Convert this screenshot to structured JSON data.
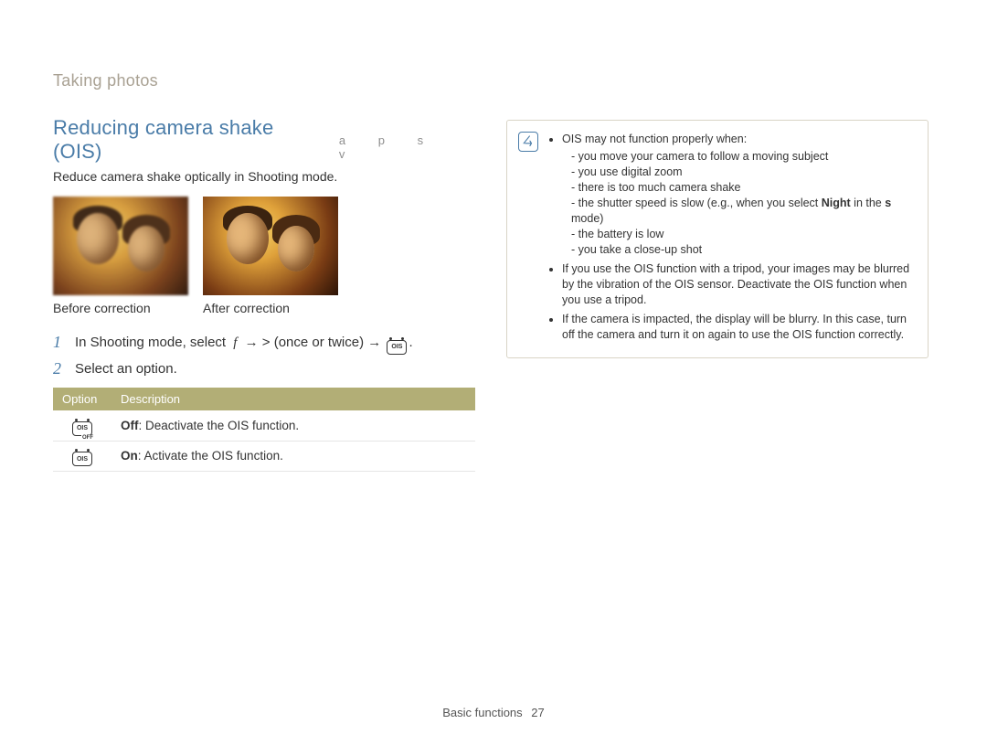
{
  "breadcrumb": "Taking photos",
  "title": "Reducing camera shake (OIS)",
  "mode_letters": "a   p   s      v",
  "intro": "Reduce camera shake optically in Shooting mode.",
  "captions": {
    "before": "Before correction",
    "after": "After correction"
  },
  "steps": {
    "s1_a": "In Shooting mode, select",
    "s1_b": "f",
    "s1_c": "→ > (once or twice) →",
    "s1_d": ".",
    "s2": "Select an option."
  },
  "table": {
    "headers": {
      "option": "Option",
      "description": "Description"
    },
    "rows": [
      {
        "icon_sub": "OFF",
        "bold": "Off",
        "text": ": Deactivate the OIS function."
      },
      {
        "icon_sub": "",
        "bold": "On",
        "text": ": Activate the OIS function."
      }
    ]
  },
  "note": {
    "lead": "OIS may not function properly when:",
    "reasons": [
      "you move your camera to follow a moving subject",
      "you use digital zoom",
      "there is too much camera shake"
    ],
    "shutter_a": "the shutter speed is slow (e.g., when you select ",
    "shutter_bold": "Night",
    "shutter_b": " in the ",
    "shutter_mode": "s",
    "shutter_c": " mode)",
    "reasons2": [
      "the battery is low",
      "you take a close-up shot"
    ],
    "bullet2": "If you use the OIS function with a tripod, your images may be blurred by the vibration of the OIS sensor. Deactivate the OIS function when you use a tripod.",
    "bullet3": "If the camera is impacted, the display will be blurry. In this case, turn off the camera and turn it on again to use the OIS function correctly."
  },
  "footer": {
    "section": "Basic functions",
    "page": "27"
  }
}
